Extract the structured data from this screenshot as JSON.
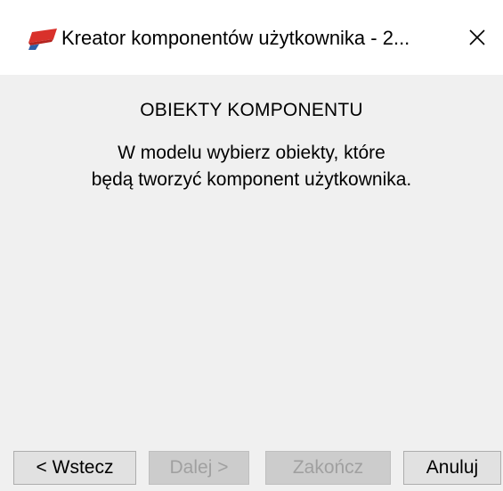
{
  "window": {
    "title": "Kreator komponentów użytkownika - 2...",
    "close_glyph": "✕",
    "icon": "red-component-icon"
  },
  "content": {
    "heading": "OBIEKTY KOMPONENTU",
    "instruction_line1": "W modelu wybierz obiekty, które",
    "instruction_line2": "będą tworzyć komponent użytkownika."
  },
  "buttons": {
    "back_label": "< Wstecz",
    "next_label": "Dalej >",
    "finish_label": "Zakończ",
    "cancel_label": "Anuluj"
  },
  "colors": {
    "dialog_bg": "#f0f0f0",
    "titlebar_bg": "#ffffff",
    "icon_red": "#d9312b",
    "icon_blue": "#2e5fa8",
    "disabled_text": "#a0a0a0"
  }
}
